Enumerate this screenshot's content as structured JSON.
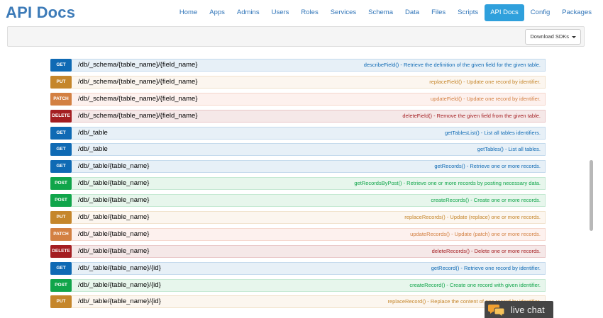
{
  "header": {
    "brand": "API Docs",
    "nav": [
      {
        "label": "Home",
        "active": false
      },
      {
        "label": "Apps",
        "active": false
      },
      {
        "label": "Admins",
        "active": false
      },
      {
        "label": "Users",
        "active": false
      },
      {
        "label": "Roles",
        "active": false
      },
      {
        "label": "Services",
        "active": false
      },
      {
        "label": "Schema",
        "active": false
      },
      {
        "label": "Data",
        "active": false
      },
      {
        "label": "Files",
        "active": false
      },
      {
        "label": "Scripts",
        "active": false
      },
      {
        "label": "API Docs",
        "active": true
      },
      {
        "label": "Config",
        "active": false
      },
      {
        "label": "Packages",
        "active": false
      }
    ]
  },
  "toolbar": {
    "download_sdks_label": "Download SDKs"
  },
  "operations": [
    {
      "method": "GET",
      "path": "/db/_schema/{table_name}/{field_name}",
      "description": "describeField() - Retrieve the definition of the given field for the given table."
    },
    {
      "method": "PUT",
      "path": "/db/_schema/{table_name}/{field_name}",
      "description": "replaceField() - Update one record by identifier."
    },
    {
      "method": "PATCH",
      "path": "/db/_schema/{table_name}/{field_name}",
      "description": "updateField() - Update one record by identifier."
    },
    {
      "method": "DELETE",
      "path": "/db/_schema/{table_name}/{field_name}",
      "description": "deleteField() - Remove the given field from the given table."
    },
    {
      "method": "GET",
      "path": "/db/_table",
      "description": "getTablesList() - List all tables identifiers."
    },
    {
      "method": "GET",
      "path": "/db/_table",
      "description": "getTables() - List all tables."
    },
    {
      "method": "GET",
      "path": "/db/_table/{table_name}",
      "description": "getRecords() - Retrieve one or more records."
    },
    {
      "method": "POST",
      "path": "/db/_table/{table_name}",
      "description": "getRecordsByPost() - Retrieve one or more records by posting necessary data."
    },
    {
      "method": "POST",
      "path": "/db/_table/{table_name}",
      "description": "createRecords() - Create one or more records."
    },
    {
      "method": "PUT",
      "path": "/db/_table/{table_name}",
      "description": "replaceRecords() - Update (replace) one or more records."
    },
    {
      "method": "PATCH",
      "path": "/db/_table/{table_name}",
      "description": "updateRecords() - Update (patch) one or more records."
    },
    {
      "method": "DELETE",
      "path": "/db/_table/{table_name}",
      "description": "deleteRecords() - Delete one or more records."
    },
    {
      "method": "GET",
      "path": "/db/_table/{table_name}/{id}",
      "description": "getRecord() - Retrieve one record by identifier."
    },
    {
      "method": "POST",
      "path": "/db/_table/{table_name}/{id}",
      "description": "createRecord() - Create one record with given identifier."
    },
    {
      "method": "PUT",
      "path": "/db/_table/{table_name}/{id}",
      "description": "replaceRecord() - Replace the content of one record by identifier."
    }
  ],
  "live_chat": {
    "label": "live chat",
    "icon": "chat-bubbles-icon"
  },
  "colors": {
    "brand": "#3d7bb8",
    "nav_active": "#2fa0dc",
    "get": "#0f6ab4",
    "put": "#c5862b",
    "patch": "#d38042",
    "delete": "#a41e22",
    "post": "#10a54a"
  }
}
